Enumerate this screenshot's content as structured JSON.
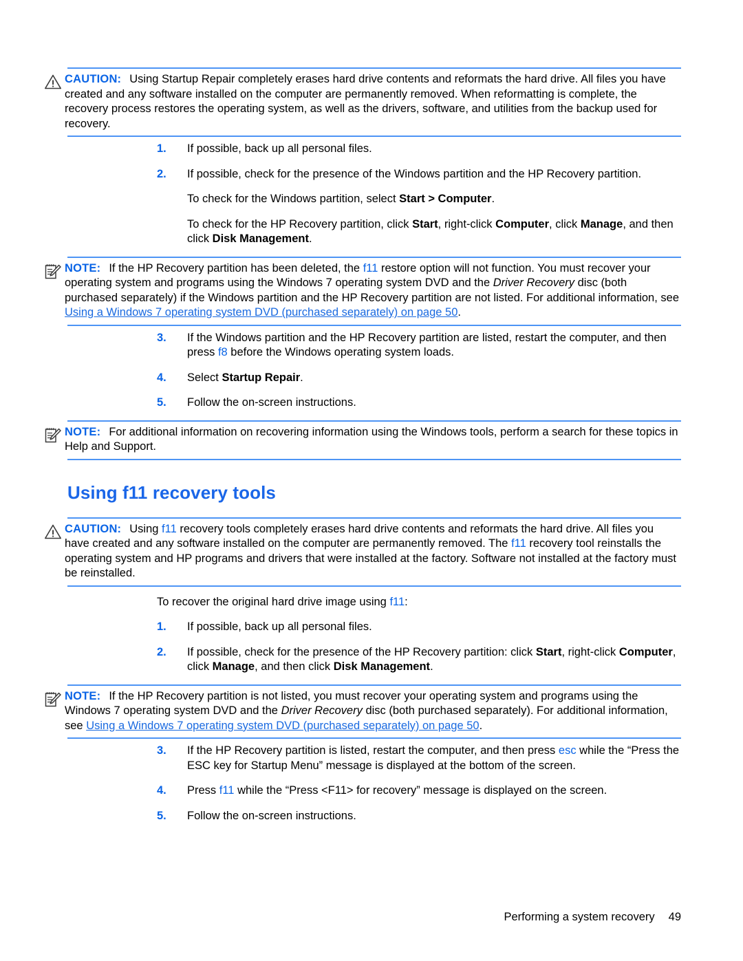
{
  "page": {
    "footer_text": "Performing a system recovery",
    "footer_page_number": "49",
    "accent_blue": "#0a64e6",
    "heading_blue": "#1a66e8",
    "rule_blue": "#4d94f5",
    "link_blue": "#1a6ae0"
  },
  "caution1": {
    "icon": "warning-triangle-icon",
    "label": "CAUTION:",
    "text": "Using Startup Repair completely erases hard drive contents and reformats the hard drive. All files you have created and any software installed on the computer are permanently removed. When reformatting is complete, the recovery process restores the operating system, as well as the drivers, software, and utilities from the backup used for recovery."
  },
  "list1": {
    "items": [
      {
        "num": "1.",
        "text": "If possible, back up all personal files."
      },
      {
        "num": "2.",
        "text": "If possible, check for the presence of the Windows partition and the HP Recovery partition."
      }
    ],
    "sub_para_1_lead": "To check for the Windows partition, select ",
    "sub_para_1_bold": "Start > Computer",
    "sub_para_1_tail": ".",
    "sub_para_2_lead": "To check for the HP Recovery partition, click ",
    "sub_para_2_b1": "Start",
    "sub_para_2_mid1": ", right-click ",
    "sub_para_2_b2": "Computer",
    "sub_para_2_mid2": ", click ",
    "sub_para_2_b3": "Manage",
    "sub_para_2_mid3": ", and then click ",
    "sub_para_2_b4": "Disk Management",
    "sub_para_2_tail": "."
  },
  "note1": {
    "icon": "note-pad-pencil-icon",
    "label": "NOTE:",
    "t1": "If the HP Recovery partition has been deleted, the ",
    "kw1": "f11",
    "t2": " restore option will not function. You must recover your operating system and programs using the Windows 7 operating system DVD and the ",
    "ital1": "Driver Recovery",
    "t3": " disc (both purchased separately) if the Windows partition and the HP Recovery partition are not listed. For additional information, see ",
    "link1": "Using a Windows 7 operating system DVD (purchased separately) on page 50",
    "t4": "."
  },
  "list2": {
    "item3_num": "3.",
    "item3_t1": "If the Windows partition and the HP Recovery partition are listed, restart the computer, and then press ",
    "item3_kw": "f8",
    "item3_t2": " before the Windows operating system loads.",
    "item4_num": "4.",
    "item4_t1": "Select ",
    "item4_bold": "Startup Repair",
    "item4_t2": ".",
    "item5_num": "5.",
    "item5_text": "Follow the on-screen instructions."
  },
  "note2": {
    "icon": "note-pad-pencil-icon",
    "label": "NOTE:",
    "text": "For additional information on recovering information using the Windows tools, perform a search for these topics in Help and Support."
  },
  "section": {
    "heading": "Using f11 recovery tools"
  },
  "caution2": {
    "icon": "warning-triangle-icon",
    "label": "CAUTION:",
    "t1": "Using ",
    "kw1": "f11",
    "t2": " recovery tools completely erases hard drive contents and reformats the hard drive. All files you have created and any software installed on the computer are permanently removed. The ",
    "kw2": "f11",
    "t3": " recovery tool reinstalls the operating system and HP programs and drivers that were installed at the factory. Software not installed at the factory must be reinstalled."
  },
  "intro2": {
    "t1": "To recover the original hard drive image using ",
    "kw1": "f11",
    "t2": ":"
  },
  "list3": {
    "item1_num": "1.",
    "item1_text": "If possible, back up all personal files.",
    "item2_num": "2.",
    "item2_t1": "If possible, check for the presence of the HP Recovery partition: click ",
    "item2_b1": "Start",
    "item2_t2": ", right-click ",
    "item2_b2": "Computer",
    "item2_t3": ", click ",
    "item2_b3": "Manage",
    "item2_t4": ", and then click ",
    "item2_b4": "Disk Management",
    "item2_t5": "."
  },
  "note3": {
    "icon": "note-pad-pencil-icon",
    "label": "NOTE:",
    "t1": "If the HP Recovery partition is not listed, you must recover your operating system and programs using the Windows 7 operating system DVD and the ",
    "ital1": "Driver Recovery",
    "t2": " disc (both purchased separately). For additional information, see ",
    "link1": "Using a Windows 7 operating system DVD (purchased separately) on page 50",
    "t3": "."
  },
  "list4": {
    "item3_num": "3.",
    "item3_t1": "If the HP Recovery partition is listed, restart the computer, and then press ",
    "item3_kw": "esc",
    "item3_t2": " while the “Press the ESC key for Startup Menu” message is displayed at the bottom of the screen.",
    "item4_num": "4.",
    "item4_t1": "Press ",
    "item4_kw": "f11",
    "item4_t2": " while the “Press <F11> for recovery” message is displayed on the screen.",
    "item5_num": "5.",
    "item5_text": "Follow the on-screen instructions."
  }
}
